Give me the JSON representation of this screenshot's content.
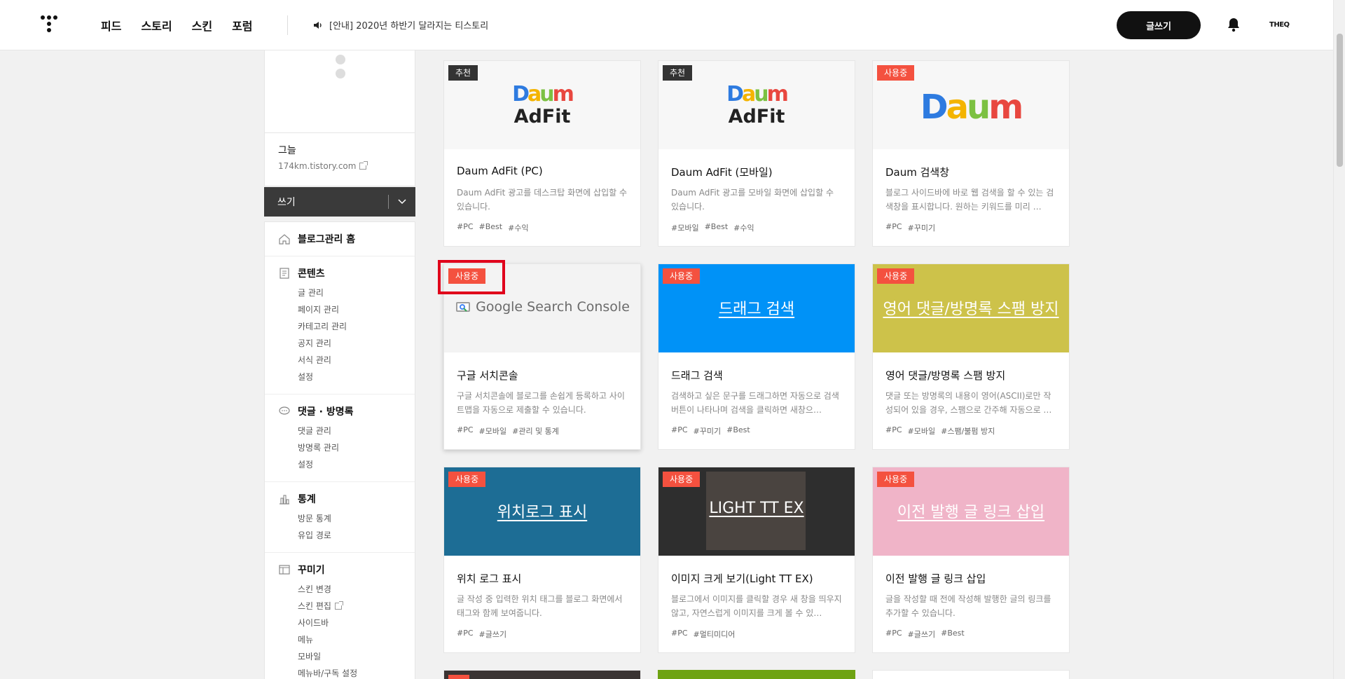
{
  "header": {
    "nav": [
      "피드",
      "스토리",
      "스킨",
      "포럼"
    ],
    "notice": "[안내] 2020년 하반기 달라지는 티스토리",
    "write_button": "글쓰기",
    "brand": "THEQ"
  },
  "sidebar": {
    "blog_name": "그늘",
    "blog_url": "174km.tistory.com",
    "write_label": "쓰기",
    "home": "블로그관리 홈",
    "groups": [
      {
        "title": "콘텐츠",
        "icon": "document-icon",
        "items": [
          "글 관리",
          "페이지 관리",
          "카테고리 관리",
          "공지 관리",
          "서식 관리",
          "설정"
        ]
      },
      {
        "title": "댓글 · 방명록",
        "icon": "comment-icon",
        "items": [
          "댓글 관리",
          "방명록 관리",
          "설정"
        ]
      },
      {
        "title": "통계",
        "icon": "chart-icon",
        "items": [
          "방문 통계",
          "유입 경로"
        ]
      },
      {
        "title": "꾸미기",
        "icon": "layout-icon",
        "items": [
          "스킨 변경",
          "스킨 편집",
          "사이드바",
          "메뉴",
          "모바일",
          "메뉴바/구독 설정"
        ]
      }
    ]
  },
  "plugins": [
    {
      "badge": "추천",
      "title": "Daum AdFit (PC)",
      "desc": "Daum AdFit 광고를 데스크탑 화면에 삽입할 수 있습니다.",
      "tags": [
        "#PC",
        "#Best",
        "#수익"
      ],
      "thumb": "adfit"
    },
    {
      "badge": "추천",
      "title": "Daum AdFit (모바일)",
      "desc": "Daum AdFit 광고를 모바일 화면에 삽입할 수 있습니다.",
      "tags": [
        "#모바일",
        "#Best",
        "#수익"
      ],
      "thumb": "adfit"
    },
    {
      "badge": "사용중",
      "title": "Daum 검색창",
      "desc": "블로그 사이드바에 바로 웹 검색을 할 수 있는 검색창을 표시합니다. 원하는 키워드를 미리 …",
      "tags": [
        "#PC",
        "#꾸미기"
      ],
      "thumb": "daum"
    },
    {
      "badge": "사용중",
      "title": "구글 서치콘솔",
      "desc": "구글 서치콘솔에 블로그를 손쉽게 등록하고 사이트맵을 자동으로 제출할 수 있습니다.",
      "tags": [
        "#PC",
        "#모바일",
        "#관리 및 통계"
      ],
      "thumb": "gsc",
      "thumb_text": "Google Search Console"
    },
    {
      "badge": "사용중",
      "title": "드래그 검색",
      "desc": "검색하고 싶은 문구를 드래그하면 자동으로 검색 버튼이 나타나며 검색을 클릭하면 새창으…",
      "tags": [
        "#PC",
        "#꾸미기",
        "#Best"
      ],
      "thumb": "blue",
      "thumb_text": "드래그 검색"
    },
    {
      "badge": "사용중",
      "title": "영어 댓글/방명록 스팸 방지",
      "desc": "댓글 또는 방명록의 내용이 영어(ASCII)로만 작성되어 있을 경우, 스팸으로 간주해 자동으로 …",
      "tags": [
        "#PC",
        "#모바일",
        "#스팸/불펌 방지"
      ],
      "thumb": "olive",
      "thumb_text": "영어 댓글/방명록 스팸 방지"
    },
    {
      "badge": "사용중",
      "title": "위치 로그 표시",
      "desc": "글 작성 중 입력한 위치 태그를 블로그 화면에서 태그와 함께 보여줍니다.",
      "tags": [
        "#PC",
        "#글쓰기"
      ],
      "thumb": "teal",
      "thumb_text": "위치로그 표시"
    },
    {
      "badge": "사용중",
      "title": "이미지 크게 보기(Light TT EX)",
      "desc": "블로그에서 이미지를 클릭할 경우 새 창을 띄우지 않고, 자연스럽게 이미지를 크게 볼 수 있…",
      "tags": [
        "#PC",
        "#멀티미디어"
      ],
      "thumb": "dark",
      "thumb_text": "LIGHT TT EX"
    },
    {
      "badge": "사용중",
      "title": "이전 발행 글 링크 삽입",
      "desc": "글을 작성할 때 전에 작성해 발행한 글의 링크를 추가할 수 있습니다.",
      "tags": [
        "#PC",
        "#글쓰기",
        "#Best"
      ],
      "thumb": "pink",
      "thumb_text": "이전 발행 글 링크 삽입"
    }
  ],
  "colors": {
    "badge_in_use": "#f4513f",
    "badge_recommended": "#333333",
    "highlight": "#e0001b"
  }
}
